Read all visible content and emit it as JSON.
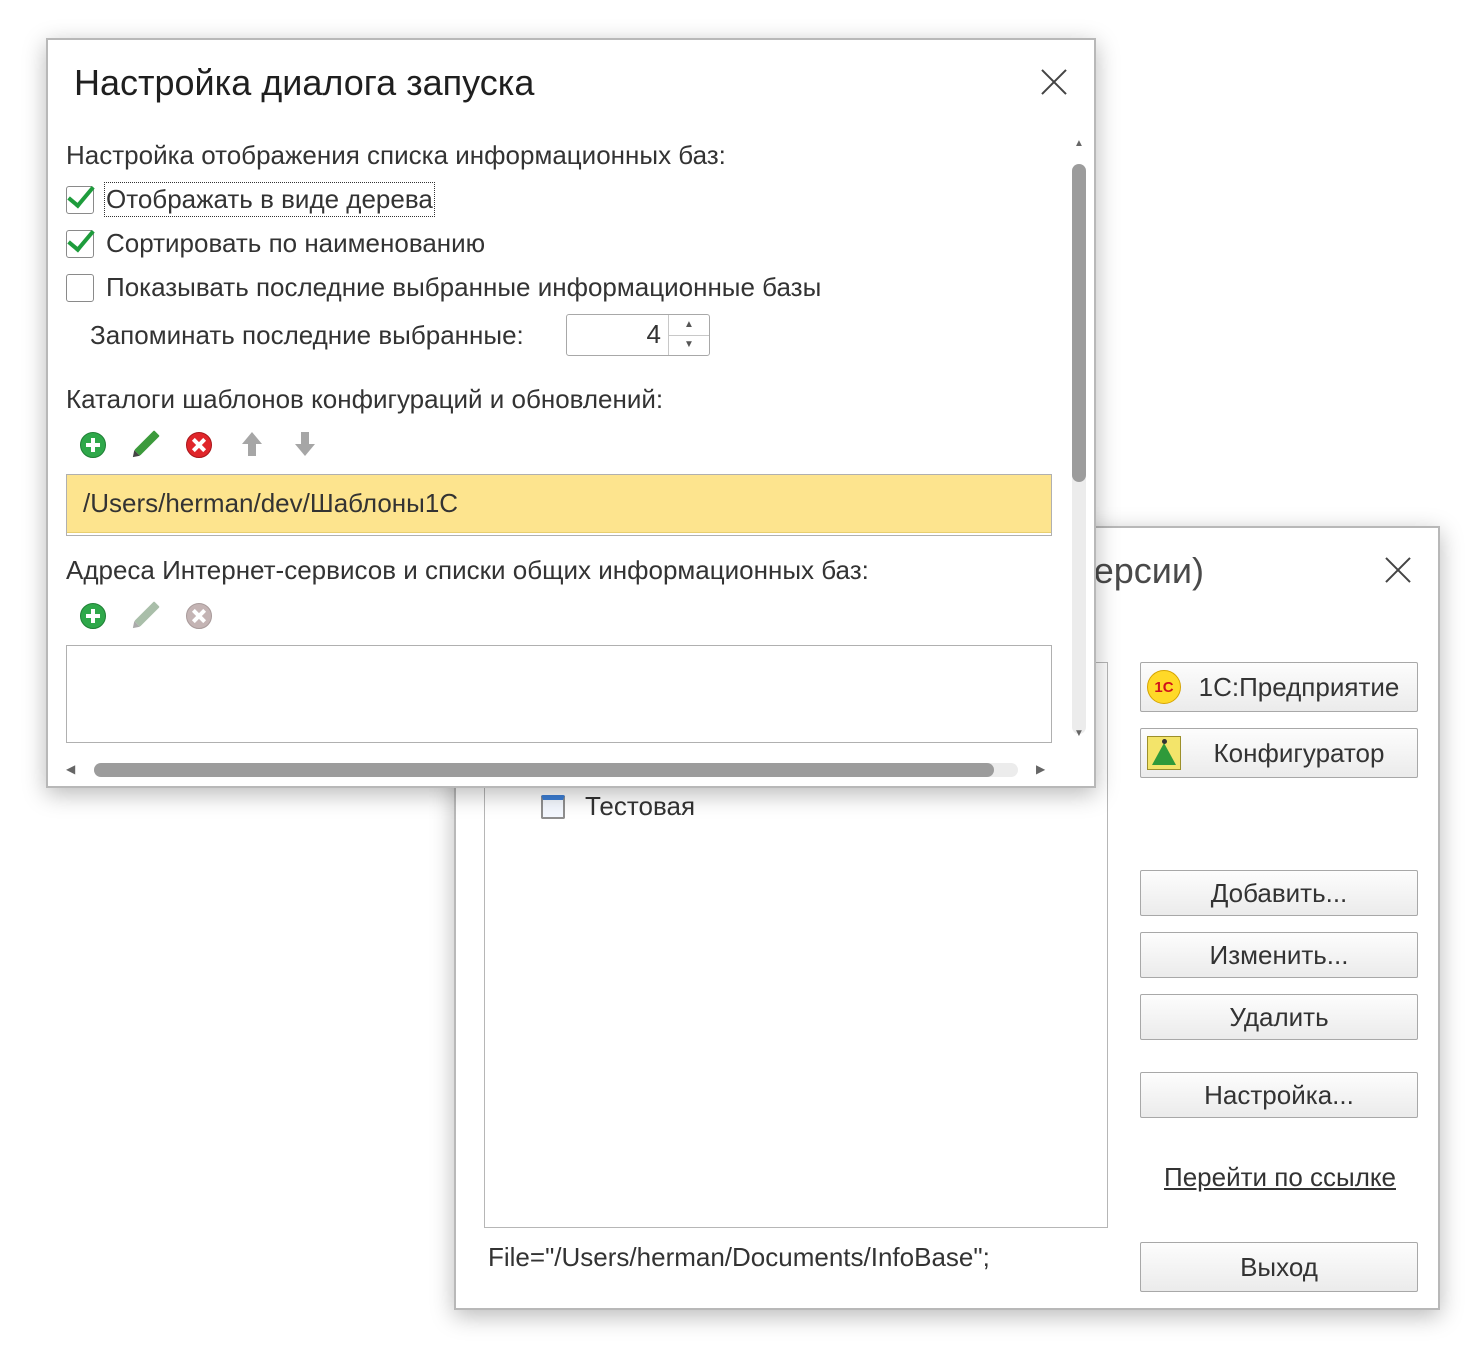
{
  "launcher": {
    "title_partial": "ерсии)",
    "infobase_item": "Тестовая",
    "connection_string": "File=\"/Users/herman/Documents/InfoBase\";",
    "buttons": {
      "enterprise": "1С:Предприятие",
      "designer": "Конфигуратор",
      "add": "Добавить...",
      "edit": "Изменить...",
      "delete": "Удалить",
      "settings": "Настройка...",
      "exit": "Выход"
    },
    "link": "Перейти по ссылке",
    "logo_1c": "1С"
  },
  "settings": {
    "title": "Настройка диалога запуска",
    "list_section_label": "Настройка отображения списка информационных баз:",
    "checkboxes": [
      {
        "label": "Отображать в виде дерева",
        "checked": true
      },
      {
        "label": "Сортировать по наименованию",
        "checked": true
      },
      {
        "label": "Показывать последние выбранные информационные базы",
        "checked": false
      }
    ],
    "remember_label": "Запоминать последние выбранные:",
    "remember_value": "4",
    "templates_label": "Каталоги шаблонов конфигураций и обновлений:",
    "templates": [
      "/Users/herman/dev/Шаблоны1С"
    ],
    "services_label": "Адреса Интернет-сервисов и списки общих информационных баз:",
    "services": [],
    "toolbar_icons": [
      "add-icon",
      "edit-icon",
      "delete-icon",
      "move-up-icon",
      "move-down-icon"
    ]
  },
  "colors": {
    "selected_row": "#fde48e",
    "check_green": "#1e9c3c",
    "add_green": "#2fa84a",
    "delete_red": "#e0262b"
  }
}
